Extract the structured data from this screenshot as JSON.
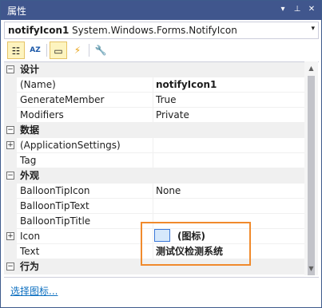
{
  "window": {
    "title": "属性",
    "pin_label": "▾",
    "autohide_label": "⊥",
    "close_label": "✕"
  },
  "object_selector": {
    "name": "notifyIcon1",
    "type": "System.Windows.Forms.NotifyIcon",
    "arrow": "▾"
  },
  "toolbar": {
    "categorized": "☷",
    "alphabetical": "AZ",
    "properties": "▭",
    "events": "⚡",
    "property_pages": "🔧"
  },
  "grid": {
    "categories": {
      "design": "设计",
      "data": "数据",
      "appearance": "外观",
      "behavior": "行为"
    },
    "design_rows": [
      {
        "name": "(Name)",
        "value": "notifyIcon1"
      },
      {
        "name": "GenerateMember",
        "value": "True"
      },
      {
        "name": "Modifiers",
        "value": "Private"
      }
    ],
    "data_rows": [
      {
        "name": "(ApplicationSettings)",
        "value": ""
      },
      {
        "name": "Tag",
        "value": ""
      }
    ],
    "appearance_rows": [
      {
        "name": "BalloonTipIcon",
        "value": "None"
      },
      {
        "name": "BalloonTipText",
        "value": ""
      },
      {
        "name": "BalloonTipTitle",
        "value": ""
      },
      {
        "name": "Icon",
        "value": "(图标)"
      },
      {
        "name": "Text",
        "value": "测试仪检测系统"
      }
    ],
    "expander_collapsed": "−",
    "expander_expanded": "+"
  },
  "scrollbar": {
    "up": "▲",
    "down": "▼"
  },
  "command_link": "选择图标..."
}
